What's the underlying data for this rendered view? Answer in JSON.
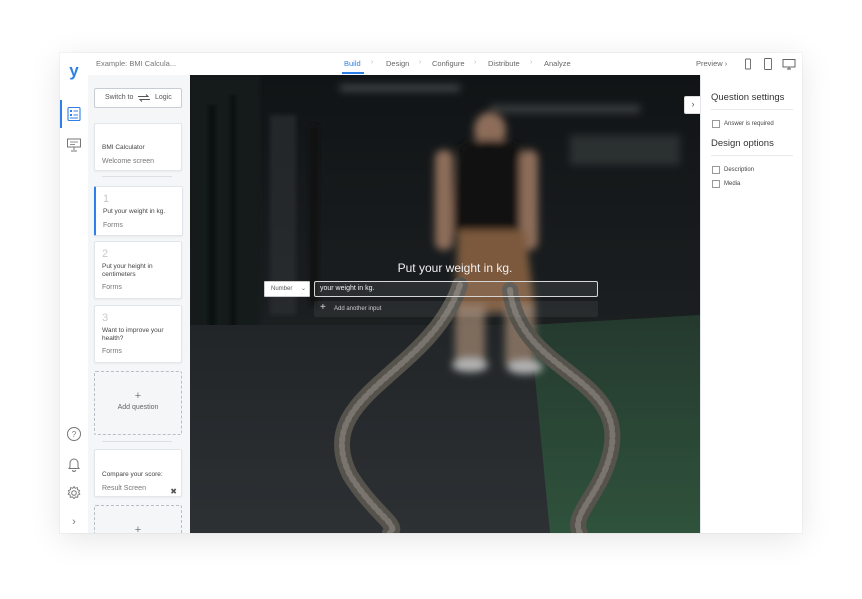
{
  "app": {
    "logo": "y",
    "breadcrumb": "Example: BMI Calcula..."
  },
  "nav": {
    "steps": [
      {
        "label": "Build",
        "active": true
      },
      {
        "label": "Design",
        "active": false
      },
      {
        "label": "Configure",
        "active": false
      },
      {
        "label": "Distribute",
        "active": false
      },
      {
        "label": "Analyze",
        "active": false
      }
    ],
    "separator": "›",
    "preview": "Preview ›",
    "device_icons": [
      "phone-icon",
      "tablet-icon",
      "desktop-icon"
    ]
  },
  "rail": {
    "top_icons": [
      "form-builder-icon",
      "presentation-icon"
    ],
    "bottom_icons": [
      "help-icon",
      "bell-icon",
      "gear-icon",
      "chevron-right-icon"
    ],
    "help_glyph": "?",
    "expand_glyph": "›"
  },
  "question_list": {
    "switch_label": "Switch to",
    "switch_target": "Logic",
    "welcome": {
      "title": "BMI Calculator",
      "type": "Welcome screen"
    },
    "questions": [
      {
        "number": "1",
        "title": "Put your weight in kg.",
        "type": "Forms",
        "selected": true
      },
      {
        "number": "2",
        "title": "Put your height in centimeters",
        "type": "Forms",
        "selected": false
      },
      {
        "number": "3",
        "title": "Want to improve your health?",
        "type": "Forms",
        "selected": false
      }
    ],
    "add_plus": "+",
    "add_label": "Add question",
    "result": {
      "title": "Compare your score:",
      "type": "Result Screen",
      "close_glyph": "✖"
    }
  },
  "canvas": {
    "question_title": "Put your weight in kg.",
    "input_type": "Number",
    "select_arrow": "⌄",
    "input_value": "your weight in kg.",
    "add_input_plus": "+",
    "add_input_label": "Add another input",
    "collapse_glyph": "›"
  },
  "settings": {
    "question_settings_title": "Question settings",
    "answer_required_label": "Answer is required",
    "design_options_title": "Design options",
    "description_label": "Description",
    "media_label": "Media"
  },
  "colors": {
    "accent": "#2f7fe8",
    "canvas_dark": "#2e3437",
    "turf_green": "#2f5a3f"
  }
}
